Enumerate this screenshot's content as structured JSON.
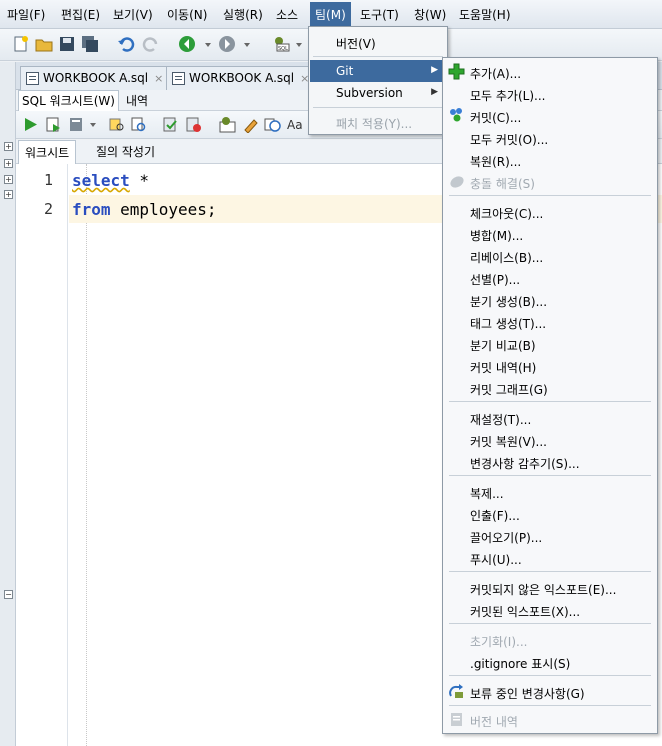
{
  "menubar": {
    "items": [
      "파일(F)",
      "편집(E)",
      "보기(V)",
      "이동(N)",
      "실행(R)",
      "소스",
      "팀(M)",
      "도구(T)",
      "창(W)",
      "도움말(H)"
    ]
  },
  "file_tabs": [
    {
      "label": "WORKBOOK A.sql",
      "close": "×"
    },
    {
      "label": "WORKBOOK A.sql",
      "close": "×"
    }
  ],
  "subtabs": {
    "worksheet": "SQL 워크시트(W)",
    "history": "내역"
  },
  "worksheet_tabs": {
    "worksheet": "워크시트",
    "query_builder": "질의 작성기"
  },
  "editor": {
    "lines": [
      {
        "num": "1",
        "kw": "select",
        "rest": " *"
      },
      {
        "num": "2",
        "kw": "from",
        "rest": " employees;"
      }
    ]
  },
  "team_menu": {
    "version": "버전(V)",
    "git": "Git",
    "subversion": "Subversion",
    "apply_patch": "패치 적용(Y)..."
  },
  "git_menu": {
    "add": "추가(A)...",
    "add_all": "모두 추가(L)...",
    "commit": "커밋(C)...",
    "commit_all": "모두 커밋(O)...",
    "restore": "복원(R)...",
    "resolve_conflict": "충돌 해결(S)",
    "checkout": "체크아웃(C)...",
    "merge": "병합(M)...",
    "rebase": "리베이스(B)...",
    "cherry_pick": "선별(P)...",
    "create_branch": "분기 생성(B)...",
    "create_tag": "태그 생성(T)...",
    "compare_branches": "분기 비교(B)",
    "commit_history": "커밋 내역(H)",
    "commit_graph": "커밋 그래프(G)",
    "reset": "재설정(T)...",
    "revert_commit": "커밋 복원(V)...",
    "stash": "변경사항 감추기(S)...",
    "clone": "복제...",
    "fetch": "인출(F)...",
    "pull": "끌어오기(P)...",
    "push": "푸시(U)...",
    "export_uncommitted": "커밋되지 않은 익스포트(E)...",
    "export_committed": "커밋된 익스포트(X)...",
    "initialize": "초기화(I)...",
    "show_gitignore": ".gitignore 표시(S)",
    "pending_changes": "보류 중인 변경사항(G)",
    "version_history": "버전 내역"
  }
}
